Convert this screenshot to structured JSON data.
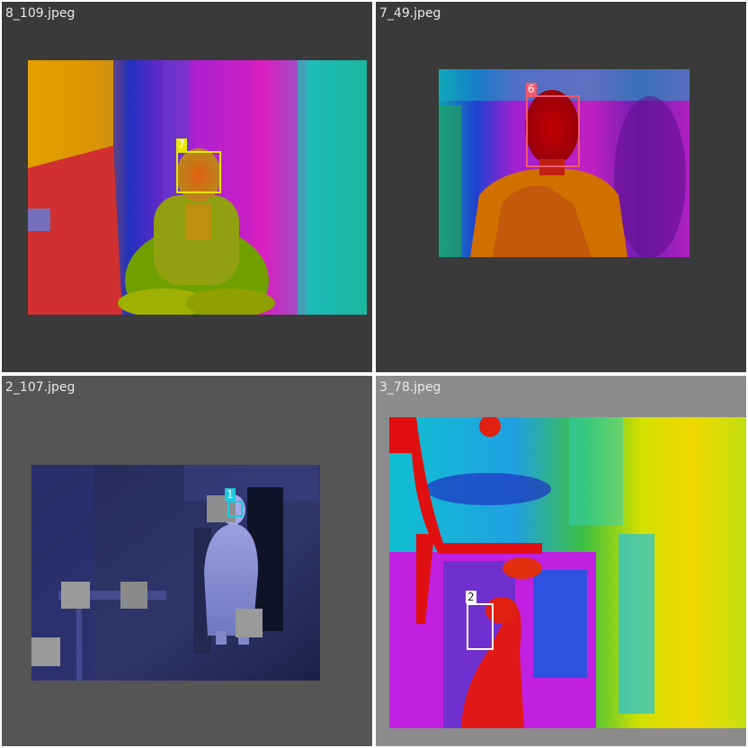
{
  "tiles": [
    {
      "filename": "8_109.jpeg",
      "background": "#3a3a3a",
      "palette": "iron-rainbow",
      "detections": [
        {
          "label": "7",
          "color": "#e6e600"
        }
      ]
    },
    {
      "filename": "7_49.jpeg",
      "background": "#3a3a3a",
      "palette": "iron-rainbow",
      "detections": [
        {
          "label": "6",
          "color": "#f05a6e"
        }
      ]
    },
    {
      "filename": "2_107.jpeg",
      "background": "#555555",
      "palette": "blue-grayscale",
      "detections": [
        {
          "label": "1",
          "color": "#20c8e0"
        }
      ]
    },
    {
      "filename": "3_78.jpeg",
      "background": "#8c8c8c",
      "palette": "rainbow",
      "detections": [
        {
          "label": "2",
          "color": "#ffffff"
        }
      ]
    }
  ]
}
